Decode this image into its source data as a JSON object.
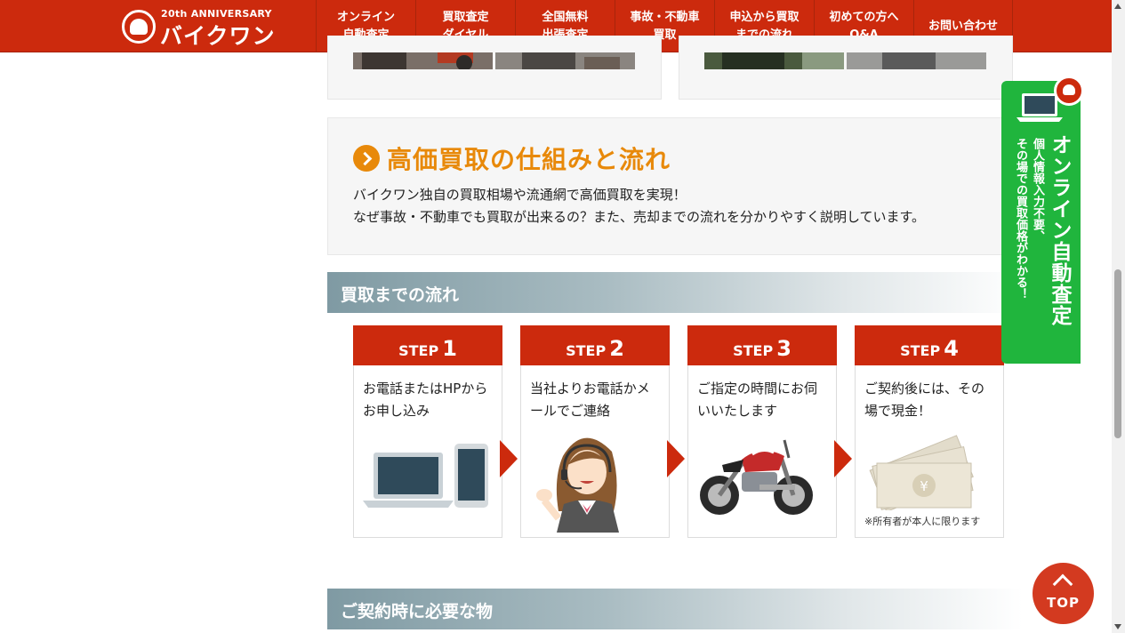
{
  "header": {
    "logo_anniversary": "20th ANNIVERSARY",
    "logo_name": "バイクワン",
    "nav": [
      {
        "label": "オンライン\n自動査定"
      },
      {
        "label": "買取査定\nダイヤル"
      },
      {
        "label": "全国無料\n出張査定"
      },
      {
        "label": "事故・不動車\n買取"
      },
      {
        "label": "申込から買取\nまでの流れ"
      },
      {
        "label": "初めての方へ\nQ&A"
      },
      {
        "label": "お問い合わせ"
      }
    ]
  },
  "info": {
    "title": "高価買取の仕組みと流れ",
    "line1": "バイクワン独自の買取相場や流通網で高価買取を実現！",
    "line2": "なぜ事故・不動車でも買取が出来るの？また、売却までの流れを分かりやすく説明しています。"
  },
  "flow_section": {
    "title": "買取までの流れ",
    "steps": [
      {
        "label": "STEP",
        "num": "1",
        "desc": "お電話またはHPからお申し込み",
        "icon": "laptop-phone-icon"
      },
      {
        "label": "STEP",
        "num": "2",
        "desc": "当社よりお電話かメールでご連絡",
        "icon": "operator-icon"
      },
      {
        "label": "STEP",
        "num": "3",
        "desc": "ご指定の時間にお伺いいたします",
        "icon": "motorcycle-icon"
      },
      {
        "label": "STEP",
        "num": "4",
        "desc": "ご契約後には、その場で現金！",
        "note": "※所有者が本人に限ります",
        "icon": "cash-icon"
      }
    ]
  },
  "next_section": {
    "title": "ご契約時に必要な物"
  },
  "side_tab": {
    "main": "オンライン自動査定",
    "sub": "個人情報入力不要、\nその場での買取価格がわかる！"
  },
  "top_button": {
    "label": "TOP"
  },
  "colors": {
    "brand_red": "#cc2a0d",
    "accent_orange": "#e8890a",
    "green": "#20b53d"
  }
}
